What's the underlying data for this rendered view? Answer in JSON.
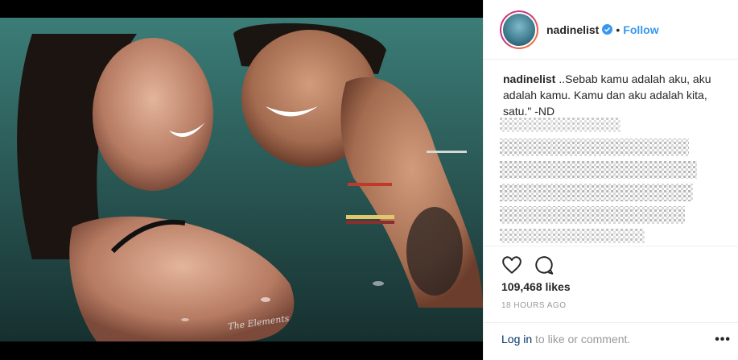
{
  "post": {
    "username": "nadinelist",
    "follow_label": "Follow",
    "separator": "•",
    "caption_user": "nadinelist",
    "caption_text": "..Sebab kamu adalah aku, aku adalah kamu. Kamu dan aku adalah kita, satu.\" -ND",
    "likes": "109,468 likes",
    "timestamp": "18 HOURS AGO",
    "login_link": "Log in",
    "login_rest": " to like or comment.",
    "more_label": "•••",
    "icons": {
      "verified": "verified-badge-icon",
      "like": "heart-icon",
      "comment": "comment-icon",
      "more": "more-options-icon"
    },
    "watermark": "The Elements"
  },
  "colors": {
    "accent": "#3897f0",
    "link": "#003569",
    "muted": "#999999",
    "text": "#262626",
    "border": "#efefef"
  }
}
